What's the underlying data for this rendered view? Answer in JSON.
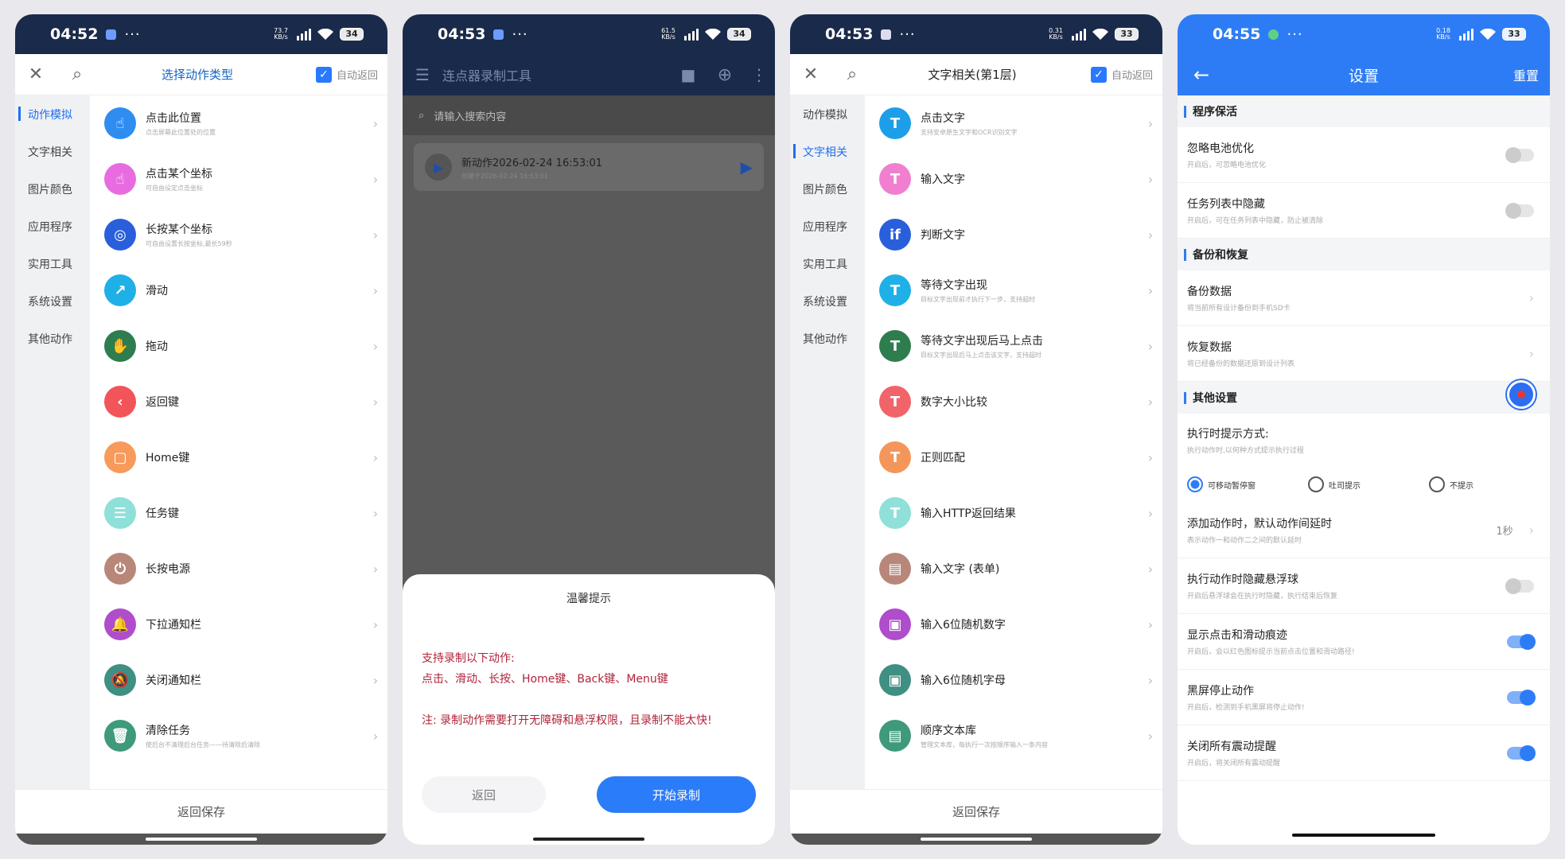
{
  "phone1": {
    "status": {
      "time": "04:52",
      "speed": "73.7\nKB/s",
      "battery": "34"
    },
    "topbar": {
      "title": "选择动作类型",
      "auto_label": "自动返回"
    },
    "sidebar": [
      "动作模拟",
      "文字相关",
      "图片颜色",
      "应用程序",
      "实用工具",
      "系统设置",
      "其他动作"
    ],
    "items": [
      {
        "title": "点击此位置",
        "sub": "点击屏幕此位置处的位置",
        "color": "#2f8df2",
        "glyph": "☝"
      },
      {
        "title": "点击某个坐标",
        "sub": "可自由设定点击坐标",
        "color": "#e86ce0",
        "glyph": "☝"
      },
      {
        "title": "长按某个坐标",
        "sub": "可自由设置长按坐标,最长59秒",
        "color": "#2a5fdc",
        "glyph": "◎"
      },
      {
        "title": "滑动",
        "sub": "",
        "color": "#1fb0e8",
        "glyph": "↗"
      },
      {
        "title": "拖动",
        "sub": "",
        "color": "#2e7d4f",
        "glyph": "✋"
      },
      {
        "title": "返回键",
        "sub": "",
        "color": "#f1555a",
        "glyph": "‹"
      },
      {
        "title": "Home键",
        "sub": "",
        "color": "#f79a5c",
        "glyph": "▢"
      },
      {
        "title": "任务键",
        "sub": "",
        "color": "#8fe0d8",
        "glyph": "☰"
      },
      {
        "title": "长按电源",
        "sub": "",
        "color": "#b8877a",
        "glyph": "⏻"
      },
      {
        "title": "下拉通知栏",
        "sub": "",
        "color": "#b04dcc",
        "glyph": "🔔"
      },
      {
        "title": "关闭通知栏",
        "sub": "",
        "color": "#3f8f82",
        "glyph": "🔕"
      },
      {
        "title": "清除任务",
        "sub": "使后台不清理后台任务——待清除后清除",
        "color": "#3e9a7a",
        "glyph": "🗑"
      }
    ],
    "bottom": "返回保存"
  },
  "phone2": {
    "status": {
      "time": "04:53",
      "speed": "61.5\nKB/s",
      "battery": "34"
    },
    "title": "连点器录制工具",
    "search_placeholder": "请输入搜索内容",
    "card": {
      "title": "新动作2026-02-24 16:53:01",
      "sub": "创建于2026-02-24 16:53:01"
    },
    "dialog": {
      "title": "温馨提示",
      "line1": "支持录制以下动作:",
      "line2": "点击、滑动、长按、Home键、Back键、Menu键",
      "line3": "注: 录制动作需要打开无障碍和悬浮权限，且录制不能太快!",
      "back": "返回",
      "start": "开始录制"
    }
  },
  "phone3": {
    "status": {
      "time": "04:53",
      "speed": "0.31\nKB/s",
      "battery": "33"
    },
    "topbar": {
      "title": "文字相关(第1层)",
      "auto_label": "自动返回"
    },
    "sidebar": [
      "动作模拟",
      "文字相关",
      "图片颜色",
      "应用程序",
      "实用工具",
      "系统设置",
      "其他动作"
    ],
    "items": [
      {
        "title": "点击文字",
        "sub": "支持安卓原生文字和OCR识别文字",
        "color": "#1c9fe8",
        "glyph": "T"
      },
      {
        "title": "输入文字",
        "sub": "",
        "color": "#f07fcf",
        "glyph": "T"
      },
      {
        "title": "判断文字",
        "sub": "",
        "color": "#2a5fdc",
        "glyph": "if"
      },
      {
        "title": "等待文字出现",
        "sub": "目标文字出现前才执行下一步，支持超时",
        "color": "#1fb0e8",
        "glyph": "T"
      },
      {
        "title": "等待文字出现后马上点击",
        "sub": "目标文字出现后马上点击该文字，支持超时",
        "color": "#2e7d4f",
        "glyph": "T"
      },
      {
        "title": "数字大小比较",
        "sub": "",
        "color": "#f0646a",
        "glyph": "T"
      },
      {
        "title": "正则匹配",
        "sub": "",
        "color": "#f4965a",
        "glyph": "T"
      },
      {
        "title": "输入HTTP返回结果",
        "sub": "",
        "color": "#8fe0d8",
        "glyph": "T"
      },
      {
        "title": "输入文字 (表单)",
        "sub": "",
        "color": "#b8877a",
        "glyph": "▤"
      },
      {
        "title": "输入6位随机数字",
        "sub": "",
        "color": "#b04dcc",
        "glyph": "▣"
      },
      {
        "title": "输入6位随机字母",
        "sub": "",
        "color": "#3f8f82",
        "glyph": "▣"
      },
      {
        "title": "顺序文本库",
        "sub": "管理文本库，每执行一次按顺序输入一条内容",
        "color": "#3e9a7a",
        "glyph": "▤"
      }
    ],
    "bottom": "返回保存"
  },
  "phone4": {
    "status": {
      "time": "04:55",
      "speed": "0.18\nKB/s",
      "battery": "33"
    },
    "title": "设置",
    "reset": "重置",
    "sections": {
      "keepalive": "程序保活",
      "backup": "备份和恢复",
      "other": "其他设置"
    },
    "rows": {
      "battery": {
        "title": "忽略电池优化",
        "sub": "开启后，可忽略电池优化"
      },
      "hide": {
        "title": "任务列表中隐藏",
        "sub": "开启后，可在任务列表中隐藏，防止被清除"
      },
      "backup": {
        "title": "备份数据",
        "sub": "将当前所有设计备份到手机SD卡"
      },
      "restore": {
        "title": "恢复数据",
        "sub": "将已经备份的数据还原到设计列表"
      },
      "prompt": {
        "title": "执行时提示方式:",
        "sub": "执行动作时,以何种方式提示执行过程"
      },
      "delay": {
        "title": "添加动作时，默认动作间延时",
        "sub": "表示动作一和动作二之间的默认延时",
        "value": "1秒"
      },
      "hideball": {
        "title": "执行动作时隐藏悬浮球",
        "sub": "开启后悬浮球会在执行时隐藏，执行结束后恢复"
      },
      "trace": {
        "title": "显示点击和滑动痕迹",
        "sub": "开启后，会以红色图标提示当前点击位置和滑动路径!"
      },
      "screenoff": {
        "title": "黑屏停止动作",
        "sub": "开启后，检测到手机黑屏将停止动作!"
      },
      "vibrate": {
        "title": "关闭所有震动提醒",
        "sub": "开启后，将关闭所有震动提醒"
      }
    },
    "radio": [
      "可移动暂停窗",
      "吐司提示",
      "不提示"
    ]
  }
}
